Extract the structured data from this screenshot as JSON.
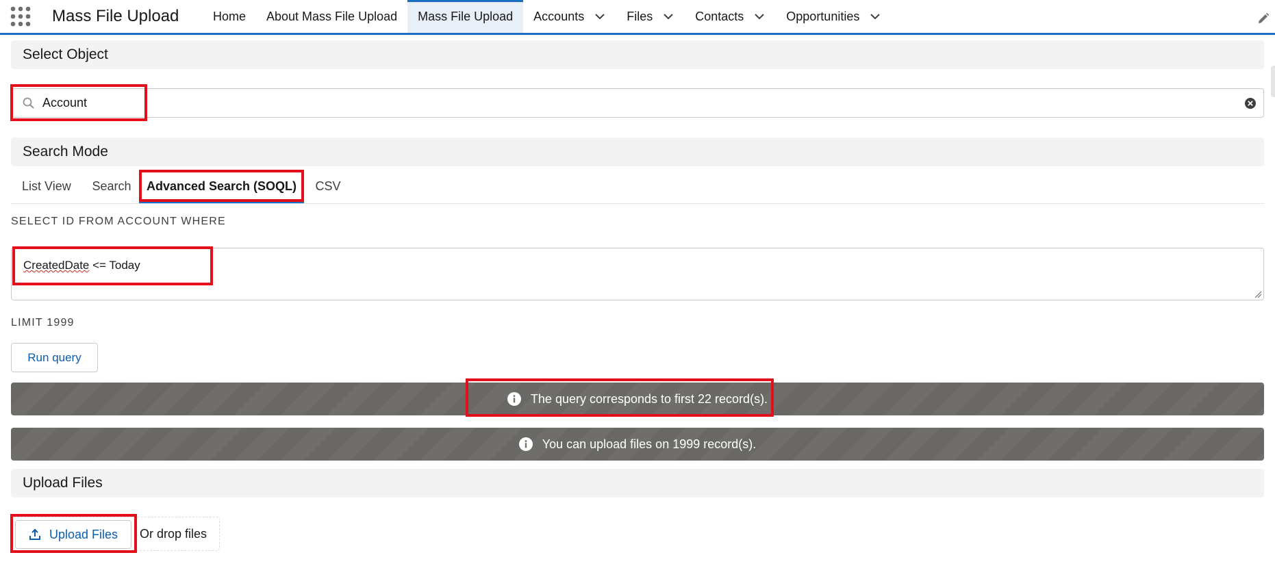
{
  "app": {
    "title": "Mass File Upload"
  },
  "nav": {
    "items": [
      {
        "label": "Home"
      },
      {
        "label": "About Mass File Upload"
      },
      {
        "label": "Mass File Upload"
      },
      {
        "label": "Accounts"
      },
      {
        "label": "Files"
      },
      {
        "label": "Contacts"
      },
      {
        "label": "Opportunities"
      }
    ]
  },
  "select_object": {
    "header": "Select Object",
    "value": "Account"
  },
  "search_mode": {
    "header": "Search Mode",
    "tabs": [
      {
        "label": "List View"
      },
      {
        "label": "Search"
      },
      {
        "label": "Advanced Search (SOQL)"
      },
      {
        "label": "CSV"
      }
    ],
    "active_tab": "Advanced Search (SOQL)"
  },
  "query": {
    "prefix_label": "SELECT ID FROM ACCOUNT WHERE",
    "field": "CreatedDate",
    "rest": " <= Today",
    "limit_label": "LIMIT 1999",
    "run_button": "Run query"
  },
  "messages": {
    "query_result": "The query corresponds to first 22 record(s).",
    "upload_capacity": "You can upload files on 1999 record(s)."
  },
  "upload": {
    "header": "Upload Files",
    "button": "Upload Files",
    "drop_text": "Or drop files"
  },
  "colors": {
    "brand": "#1b6ec2",
    "link": "#0b5cab",
    "banner": "#706e6b",
    "highlight": "#e3101c"
  }
}
